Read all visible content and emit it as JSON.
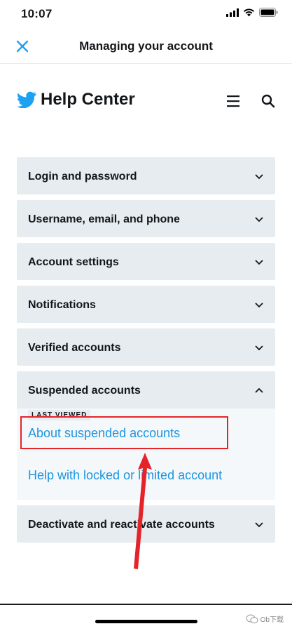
{
  "status_bar": {
    "time": "10:07",
    "icons": [
      "signal-icon",
      "wifi-icon",
      "battery-icon"
    ]
  },
  "nav": {
    "title": "Managing your account",
    "close_icon": "close-icon"
  },
  "help_center": {
    "logo_text": "Help Center",
    "brand_color": "#1da1f2"
  },
  "accordion": {
    "items": [
      {
        "label": "Login and password",
        "expanded": false
      },
      {
        "label": "Username, email, and phone",
        "expanded": false
      },
      {
        "label": "Account settings",
        "expanded": false
      },
      {
        "label": "Notifications",
        "expanded": false
      },
      {
        "label": "Verified accounts",
        "expanded": false
      },
      {
        "label": "Suspended accounts",
        "expanded": true,
        "badge": "LAST VIEWED",
        "links": [
          "About suspended accounts",
          "Help with locked or limited account"
        ]
      },
      {
        "label": "Deactivate and reactivate accounts",
        "expanded": false
      }
    ]
  },
  "annotation": {
    "color": "#e5242a"
  },
  "watermark": {
    "text": "Ob下载"
  },
  "colors": {
    "link": "#1b95e0",
    "panel": "#e6ecf0"
  }
}
